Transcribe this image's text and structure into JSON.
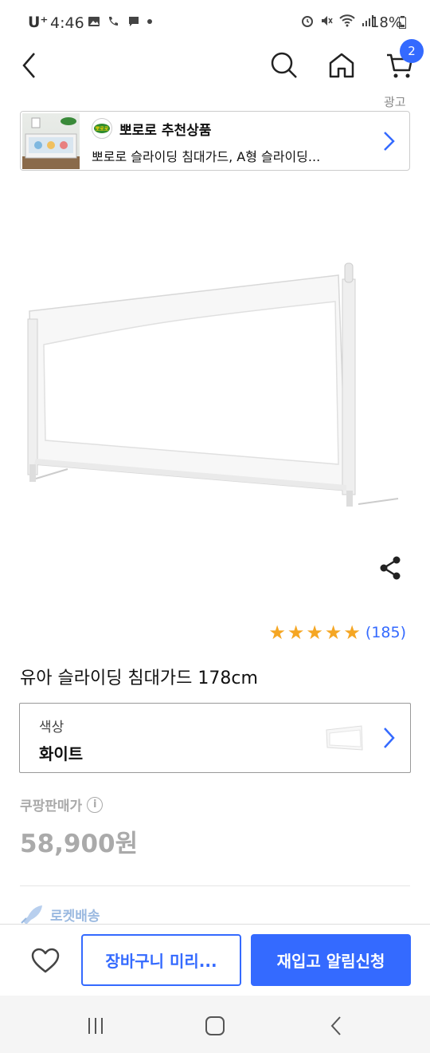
{
  "status_bar": {
    "carrier": "U⁺",
    "time": "4:46",
    "battery": "18%"
  },
  "header": {
    "cart_count": "2"
  },
  "ad": {
    "label": "광고",
    "brand": "뽀로로 추천상품",
    "logo_text": "뽀로로",
    "description": "뽀로로 슬라이딩 침대가드, A형 슬라이딩..."
  },
  "product": {
    "rating_stars": 5,
    "review_count": "(185)",
    "title": "유아 슬라이딩 침대가드 178cm",
    "option_label": "색상",
    "option_value": "화이트",
    "price_label": "쿠팡판매가",
    "price": "58,900원",
    "shipping": "로켓배송"
  },
  "actions": {
    "cart_label": "장바구니 미리...",
    "notify_label": "재입고 알림신청"
  },
  "colors": {
    "accent": "#346aff",
    "star": "#f5a623"
  }
}
